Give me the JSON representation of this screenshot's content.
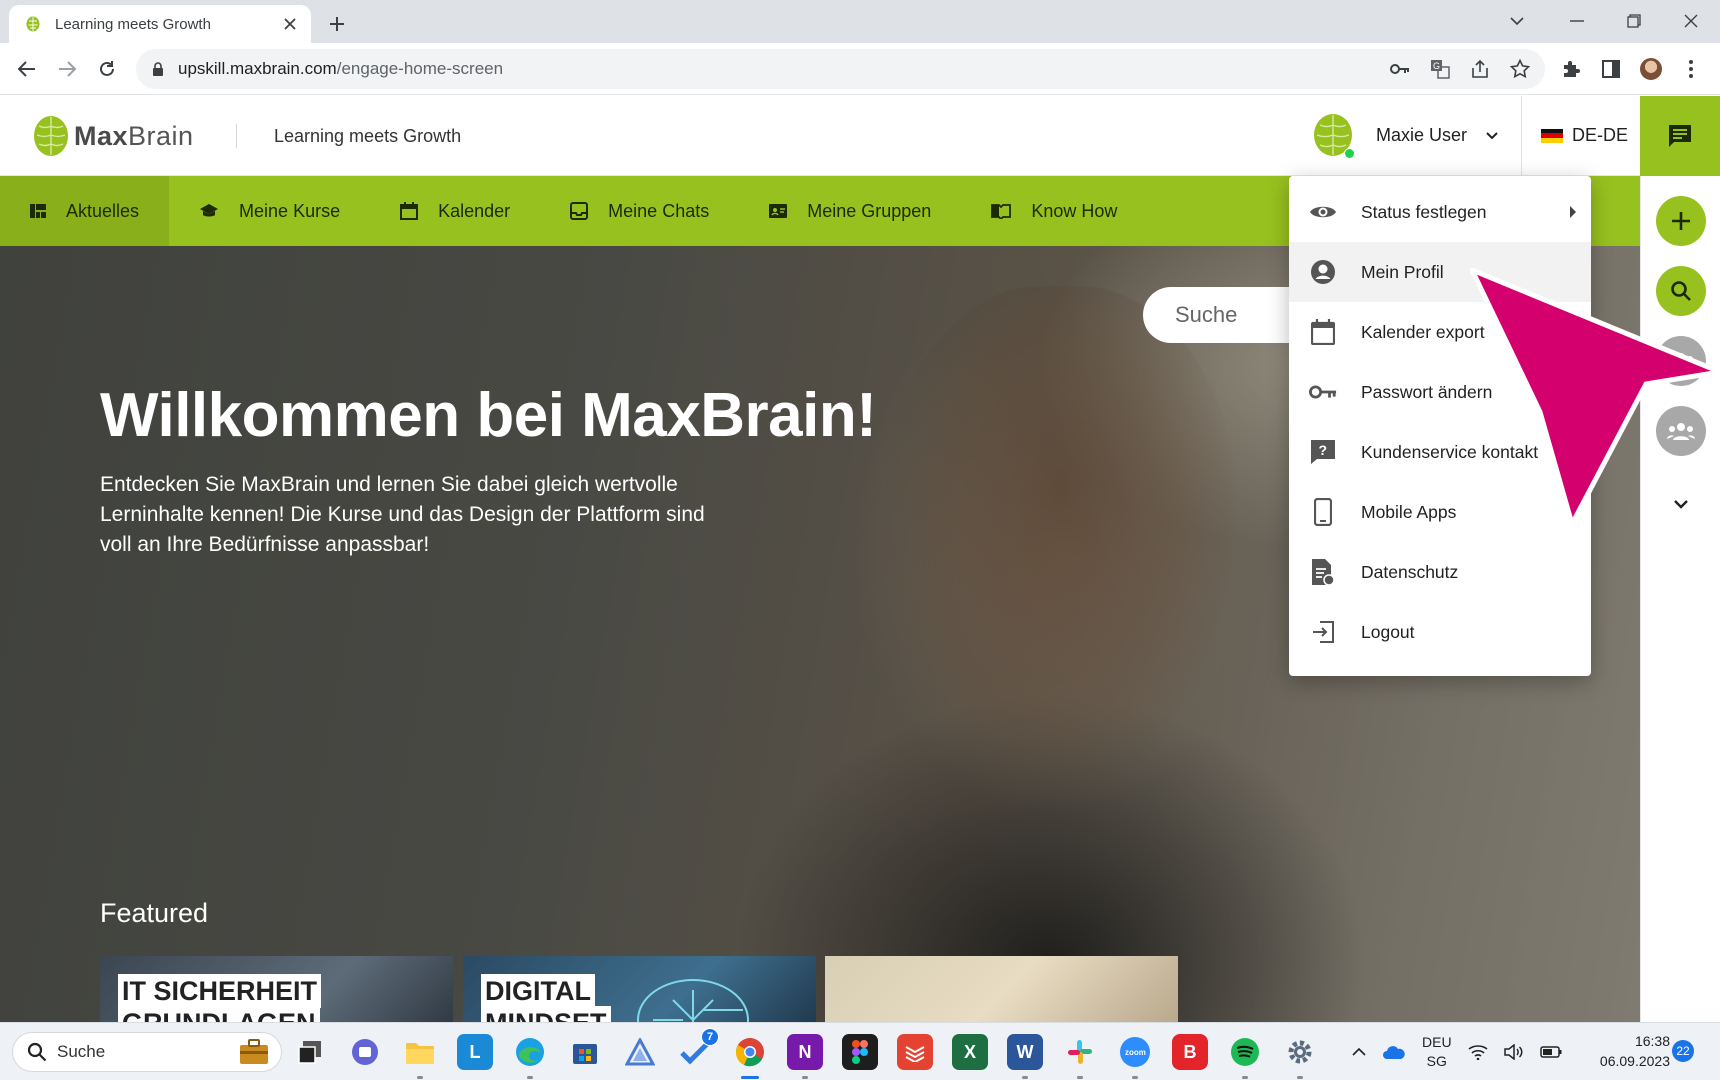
{
  "browser": {
    "tab_title": "Learning meets Growth",
    "url_host": "upskill.maxbrain.com",
    "url_path": "/engage-home-screen"
  },
  "header": {
    "logo_bold": "Max",
    "logo_light": "Brain",
    "tagline": "Learning meets Growth",
    "user_name": "Maxie User",
    "language": "DE-DE"
  },
  "nav": {
    "items": [
      {
        "label": "Aktuelles",
        "icon": "dashboard-icon"
      },
      {
        "label": "Meine Kurse",
        "icon": "graduation-cap-icon"
      },
      {
        "label": "Kalender",
        "icon": "calendar-icon"
      },
      {
        "label": "Meine Chats",
        "icon": "inbox-icon"
      },
      {
        "label": "Meine Gruppen",
        "icon": "contact-card-icon"
      },
      {
        "label": "Know How",
        "icon": "book-icon"
      }
    ]
  },
  "hero": {
    "title": "Willkommen bei MaxBrain!",
    "subtitle": "Entdecken Sie MaxBrain und lernen Sie dabei gleich wertvolle Lerninhalte kennen! Die Kurse und das Design der Plattform sind voll an Ihre Bedürfnisse anpassbar!",
    "search_placeholder": "Suche",
    "featured_label": "Featured",
    "cards": [
      {
        "line1": "IT SICHERHEIT",
        "line2": "GRUNDLAGEN"
      },
      {
        "line1": "DIGITAL",
        "line2": "MINDSET"
      },
      {
        "line1": "",
        "line2": ""
      }
    ]
  },
  "user_menu": {
    "items": [
      {
        "label": "Status festlegen",
        "icon": "eye-icon"
      },
      {
        "label": "Mein Profil",
        "icon": "account-circle-icon"
      },
      {
        "label": "Kalender export",
        "icon": "calendar-icon"
      },
      {
        "label": "Passwort ändern",
        "icon": "key-icon"
      },
      {
        "label": "Kundenservice kontakt",
        "icon": "help-chat-icon"
      },
      {
        "label": "Mobile Apps",
        "icon": "smartphone-icon"
      },
      {
        "label": "Datenschutz",
        "icon": "privacy-file-icon"
      },
      {
        "label": "Logout",
        "icon": "logout-icon"
      }
    ]
  },
  "taskbar": {
    "search_label": "Suche",
    "lang_top": "DEU",
    "lang_bottom": "SG",
    "time": "16:38",
    "date": "06.09.2023",
    "notification_count": "22",
    "todo_badge": "7"
  },
  "colors": {
    "brand_green": "#97c11f",
    "arrow_magenta": "#d4006e"
  }
}
